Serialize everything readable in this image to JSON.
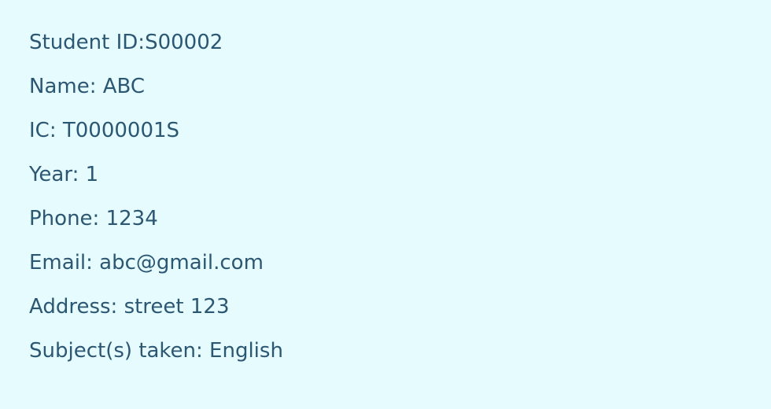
{
  "student": {
    "id_line": "Student ID:S00002",
    "name_line": "Name: ABC",
    "ic_line": "IC: T0000001S",
    "year_line": "Year: 1",
    "phone_line": "Phone: 1234",
    "email_line": "Email: abc@gmail.com",
    "address_line": "Address: street 123",
    "subjects_line": "Subject(s) taken: English"
  },
  "colors": {
    "background": "#e5fbfe",
    "text": "#2c5773"
  }
}
